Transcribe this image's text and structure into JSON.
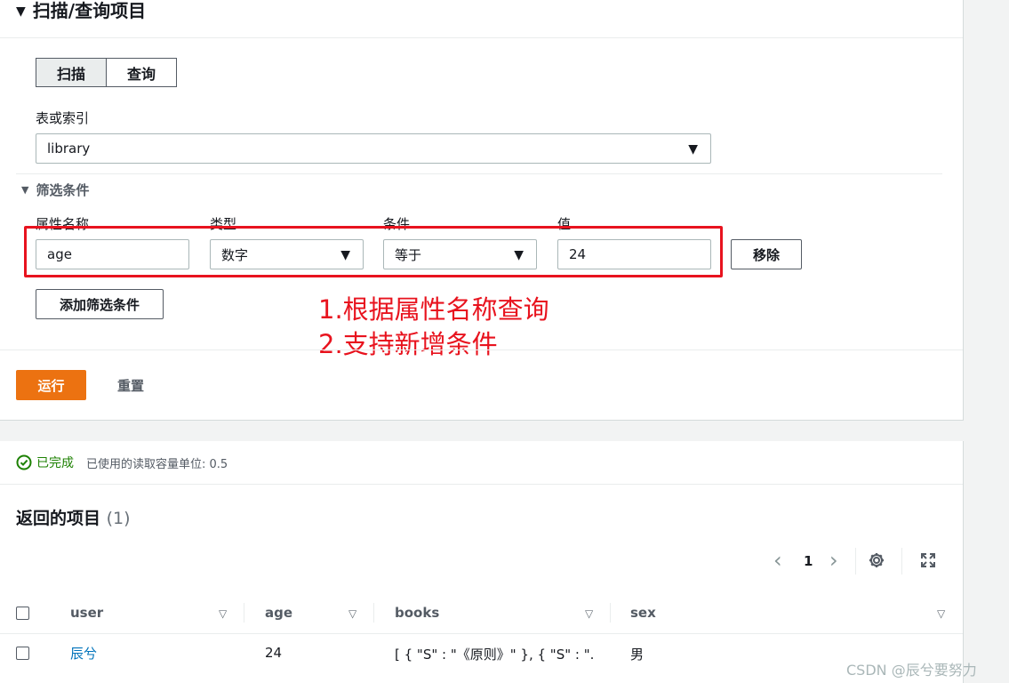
{
  "scan_panel": {
    "title": "扫描/查询项目",
    "mode_tabs": [
      "扫描",
      "查询"
    ],
    "table_label": "表或索引",
    "table_value": "library",
    "filter_section_title": "筛选条件",
    "filter_headers": {
      "attribute": "属性名称",
      "type": "类型",
      "condition": "条件",
      "value": "值"
    },
    "filter_row": {
      "attribute": "age",
      "type": "数字",
      "condition": "等于",
      "value": "24",
      "remove_label": "移除"
    },
    "add_filter_label": "添加筛选条件",
    "run_label": "运行",
    "reset_label": "重置"
  },
  "annotation": {
    "line1": "1.根据属性名称查询",
    "line2": "2.支持新增条件",
    "color": "#e8131e"
  },
  "results": {
    "status": "已完成",
    "capacity_text": "已使用的读取容量单位: 0.5",
    "title": "返回的项目",
    "count": "(1)",
    "page": "1",
    "columns": [
      "user",
      "age",
      "books",
      "sex"
    ],
    "rows": [
      {
        "user": "辰兮",
        "age": "24",
        "books": "[ { \"S\" : \"《原则》\" }, { \"S\" : \"...",
        "sex": "男"
      }
    ]
  },
  "watermark": "CSDN @辰兮要努力",
  "colors": {
    "primary": "#ec7211",
    "link": "#0073bb",
    "success": "#1d8102"
  }
}
